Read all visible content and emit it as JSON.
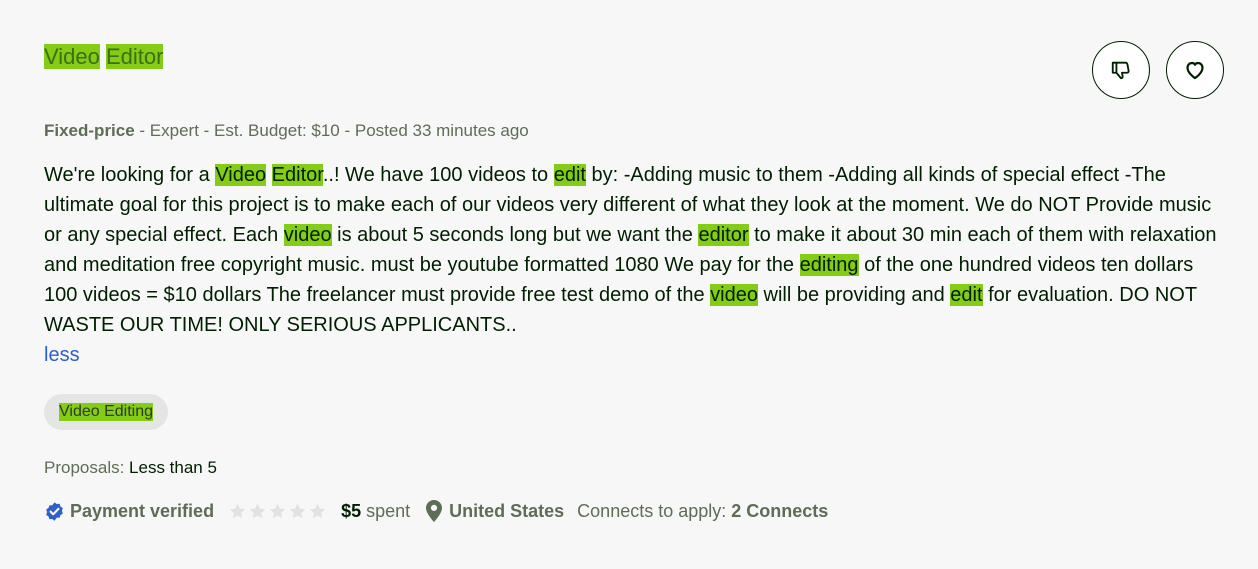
{
  "job": {
    "title_words": [
      "Video",
      "Editor"
    ],
    "meta": {
      "type": "Fixed-price",
      "rest": " - Expert - Est. Budget: $10 - Posted 33 minutes ago"
    },
    "description": {
      "p1": "We're looking for a ",
      "h1": "Video",
      "p2": " ",
      "h2": "Editor",
      "p3": "..! We have 100 videos to ",
      "h3": "edit",
      "p4": " by: -Adding music to them -Adding all kinds of special effect -The ultimate goal for this project is to make each of our videos very different of what they look at the moment. We do NOT Provide music or any special effect. Each ",
      "h4": "video",
      "p5": " is about 5 seconds long but we want the ",
      "h5": "editor",
      "p6": " to make it about 30 min each of them with relaxation and meditation free copyright music. must be youtube formatted 1080 We pay for the ",
      "h6": "editing",
      "p7": " of the one hundred videos ten dollars 100 videos = $10 dollars The freelancer must provide free test demo of the ",
      "h7": "video",
      "p8": " will be providing and ",
      "h8": "edit",
      "p9": " for evaluation. DO NOT WASTE OUR TIME! ONLY SERIOUS APPLICANTS.."
    },
    "less_label": "less",
    "skill": "Video Editing",
    "proposals": {
      "label": "Proposals: ",
      "value": "Less than 5"
    },
    "client": {
      "payment_label": "Payment verified",
      "rating": 0,
      "rating_max": 5,
      "spent_amount": "$5",
      "spent_label": " spent",
      "location": "United States",
      "connects_label": "Connects to apply: ",
      "connects_value": "2 Connects"
    }
  },
  "colors": {
    "highlight": "#84cc16",
    "link": "#2f5fcb",
    "verified_badge": "#2f5fcb",
    "star_empty": "#e0e3de"
  }
}
